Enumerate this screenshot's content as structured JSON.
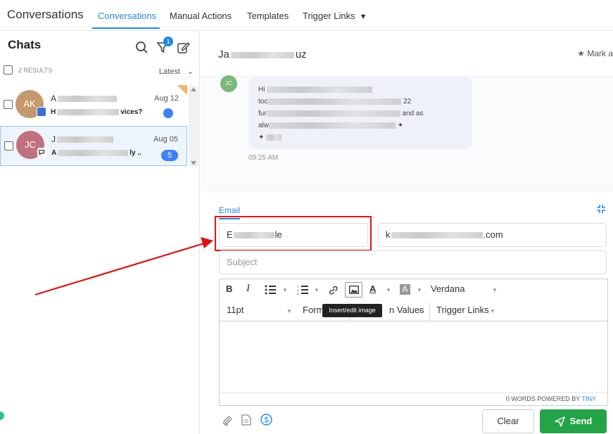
{
  "app": {
    "title": "Conversations",
    "tabs": [
      {
        "label": "Conversations",
        "active": true
      },
      {
        "label": "Manual Actions",
        "active": false
      },
      {
        "label": "Templates",
        "active": false
      },
      {
        "label": "Trigger Links",
        "active": false
      }
    ]
  },
  "sidebar": {
    "title": "Chats",
    "filter_badge": "1",
    "results": "2 RESULTS",
    "sort": "Latest",
    "chats": [
      {
        "initials": "AK",
        "avatar_color": "#c49a6c",
        "name": "A",
        "preview": "H",
        "preview_tail": "vices?",
        "date": "Aug 12",
        "unread": "",
        "selected": false
      },
      {
        "initials": "JC",
        "avatar_color": "#c0717c",
        "name": "J",
        "preview": "A",
        "preview_tail": "ly ..",
        "date": "Aug 05",
        "unread": "5",
        "selected": true
      }
    ]
  },
  "conversation": {
    "contact_name_start": "Ja",
    "contact_name_end": "uz",
    "mark_label": "Mark a",
    "sender_initials": "JC",
    "message_lines": [
      "Hi",
      "toc",
      "fur",
      "alw"
    ],
    "message_fragments": [
      "22",
      "...",
      "and as"
    ],
    "message_time": "09:25 AM"
  },
  "composer": {
    "channel_tab": "Email",
    "from_start": "E",
    "from_end": "le",
    "to_start": "k",
    "to_end": ".com",
    "subject_placeholder": "Subject",
    "toolbar": {
      "bold": "B",
      "italic": "I",
      "text_color": "A",
      "bg_color": "A",
      "font_family": "Verdana",
      "font_size": "11pt",
      "formats": "Form",
      "custom_values": "n Values",
      "trigger_links": "Trigger Links",
      "tooltip": "Insert/edit image"
    },
    "status": {
      "words": "0 WORDS POWERED BY",
      "brand": "TINY"
    },
    "clear_label": "Clear",
    "send_label": "Send"
  },
  "colors": {
    "accent": "#1e88e5",
    "send": "#22a447",
    "annotation": "#e11111"
  }
}
